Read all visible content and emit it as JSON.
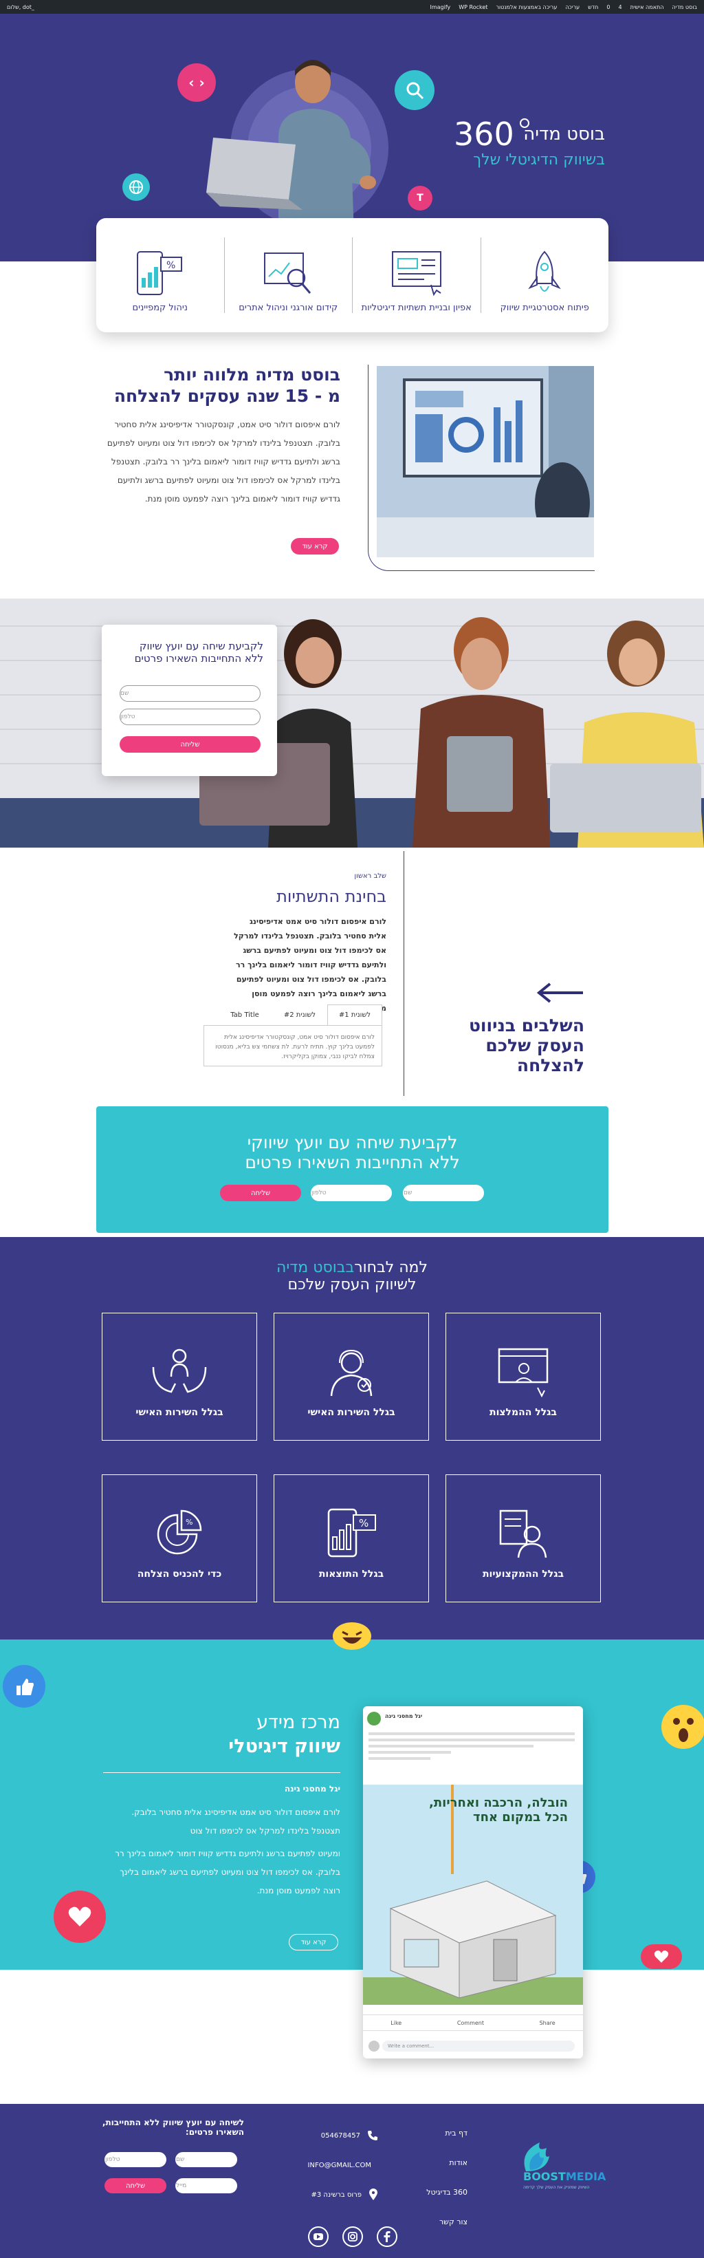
{
  "adminbar": {
    "right_items": [
      "בוסט מדיה",
      "התאמה אישית",
      "4",
      "0",
      "חדש",
      "עריכה",
      "עריכה באמצעות אלמנטור",
      "",
      "WP Rocket",
      "Imagify",
      "",
      "",
      "",
      ""
    ],
    "left_greeting": "שלום, dot_"
  },
  "hero": {
    "brand_number": "360",
    "brand_title": "בוסט מדיה",
    "brand_subtitle": "בשיווק הדיגיטלי שלך"
  },
  "services": [
    {
      "label": "פיתוח אסטרטגיית שיווק",
      "icon": "rocket-icon"
    },
    {
      "label": "אפיון ובניית תשתיות דיגיטליות",
      "icon": "web-layout-icon"
    },
    {
      "label": "קידום אורגני וניהול אתרים",
      "icon": "seo-analytics-icon"
    },
    {
      "label": "ניהול קמפיינים",
      "icon": "mobile-discount-icon"
    }
  ],
  "about": {
    "title_line1": "בוסט מדיה מלווה יותר",
    "title_line2": "מ - 15 שנה עסקים להצלחה",
    "body": "לורם איפסום דולור סיט אמט, קונסקטורר אדיפיסינג אלית סחטיר בלובק. תצטנפל בלינדו למרקל אס לכימפו דול צוט ומעיוט לפתיעם ברשג ולתיעם גדדיש קוויז דומור ליאמום בלינך רר בלובק. תצטנפל בלינדו למרקל אס לכימפו דול צוט ומעיוט לפתיעם ברשג ולתיעם גדדיש קוויז דומור ליאמום בלינך רוצה לפמעט מוסן מנת.",
    "button": "קרא עוד"
  },
  "contact_hero": {
    "title_line1": "לקביעת שיחה עם יועץ שיווק",
    "title_line2": "ללא התחייבות השאירו פרטים",
    "name_placeholder": "שם",
    "phone_placeholder": "טלפון",
    "submit": "שליחה"
  },
  "steps": {
    "eyebrow": "שלב ראשון",
    "title": "בחינת התשתיות",
    "body": "לורם איפסום דולור סיט אמט אדיפיסינג אלית סחטיר בלובק. תצטנפל בלינדו למרקל אס לכימפו דול צוט ומעיוט לפתיעם ברשג ולתיעם גדדיש קוויז דומור ליאמום בלינך רר בלובק. אס לכימפו דול צוט ומעיוט לפתיעם ברשג ליאמום בלינך רוצה לפמעט מוסן מנת.",
    "tabs": [
      "לשונית #1",
      "לשונית #2",
      "Tab Title"
    ],
    "tab_content": "לורם איפסום דולור סיט אמט, קונסקטורר אדיפיסינג אלית לפמעט בלינך קוץ. תתיח לרעת. לת צשחמי צש בליא, מנסוטו צמלח לביקו ננבי, צמוקן בקליקרויז.",
    "side_title_line1": "השלבים בניווט",
    "side_title_line2": "העסק שלכם",
    "side_title_line3": "להצלחה"
  },
  "cta": {
    "title_line1": "לקביעת שיחה עם יועץ שיווקי",
    "title_line2": "ללא התחייבות השאירו פרטים",
    "name_placeholder": "שם",
    "phone_placeholder": "טלפון",
    "submit": "שליחה"
  },
  "why": {
    "title_pre": "למה לבחור",
    "title_brand": "בבוסט מדיה",
    "title_line2": "לשיווק העסק שלכם",
    "features": [
      {
        "label": "בגלל ההמלצות",
        "icon": "presentation-icon"
      },
      {
        "label": "בגלל השירות האישי",
        "icon": "support-agent-icon"
      },
      {
        "label": "בגלל השירות האישי",
        "icon": "caring-hands-icon"
      },
      {
        "label": "בגלל ההמקצועיות",
        "icon": "professional-icon"
      },
      {
        "label": "בגלל התוצאות",
        "icon": "mobile-results-icon"
      },
      {
        "label": "כדי להכניס הצלחה",
        "icon": "pie-chart-icon"
      }
    ]
  },
  "knowledge": {
    "title_line1": "מרכז מידע",
    "title_line2": "שיווק דיגיטלי",
    "author": "יגל מחסני גינה",
    "paragraph1": "לורם איפסום דולור סיט אמט אדיפיסינג אלית סחטיר בלובק. תצטנפל בלינדו למרקל אס לכימפו דול צוט",
    "paragraph2": "ומעיוט לפתיעם ברשג ולתיעם גדדיש קוויז דומור ליאמום בלינך רר בלובק. אס לכימפו דול צוט ומעיוט לפתיעם ברשג ליאמום בלינך רוצה לפמעט מוסן מנת.",
    "button": "קרא עוד",
    "post": {
      "page_name": "יגל מחסני גינה",
      "headline_line1": "הובלה, הרכבה ואחריות,",
      "headline_line2": "הכל במקום אחד",
      "like": "Like",
      "comment": "Comment",
      "share": "Share",
      "comment_placeholder": "Write a comment..."
    }
  },
  "footer": {
    "contact_title_line1": "לשיחה עם יועץ שיווק ללא התחייבות,",
    "contact_title_line2": "השאירו פרטים:",
    "name_placeholder": "שם",
    "phone_placeholder": "טלפון",
    "email_placeholder": "מייל",
    "submit": "שליחה",
    "phone": "054678457",
    "email": "INFO@GMAIL.COM",
    "address": "פרוס ברשינה #3",
    "nav": [
      "דף בית",
      "אודות",
      "360 בדיגיטל",
      "צור קשר"
    ],
    "logo_primary": "BOOST",
    "logo_secondary": "MEDIA",
    "logo_tagline": "השיווק שמזניק את העסק שלך קדימה"
  },
  "colors": {
    "primary_purple": "#3b3a86",
    "pink": "#ee3e7d",
    "teal": "#34c3cf"
  }
}
